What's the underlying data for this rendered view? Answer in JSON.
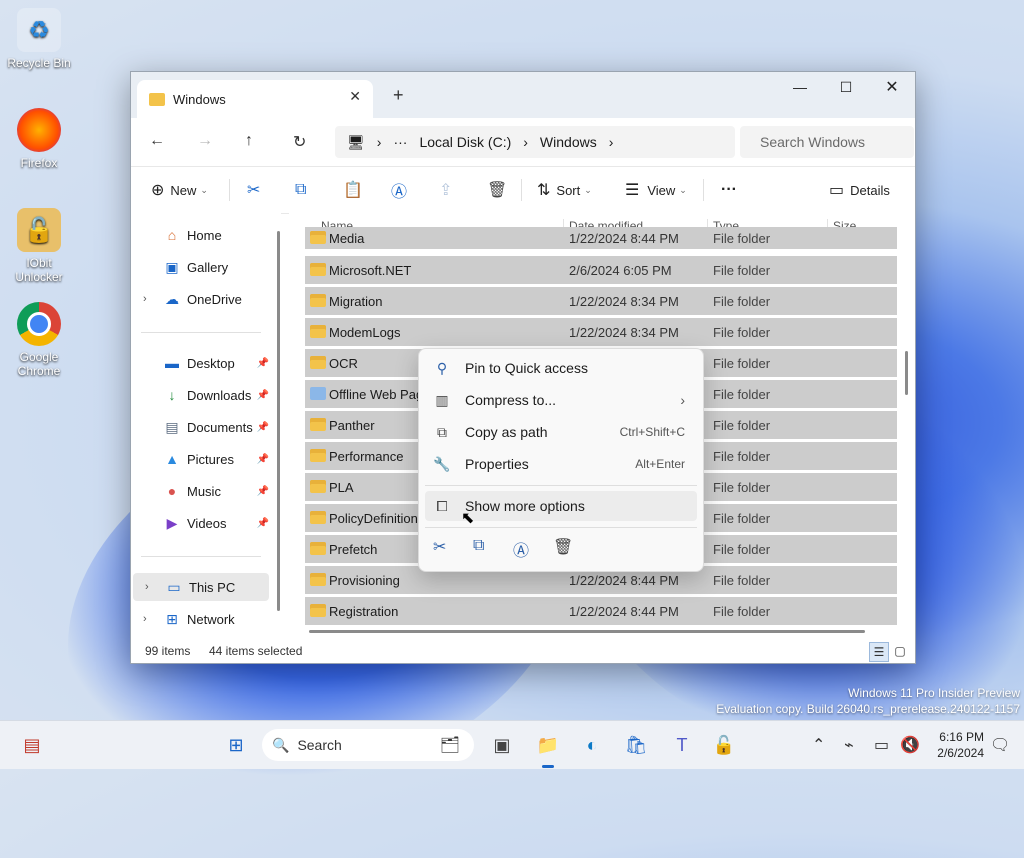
{
  "desktop": {
    "icons": [
      {
        "label": "Recycle Bin",
        "icon": "recycle-bin-icon"
      },
      {
        "label": "Firefox",
        "icon": "firefox-icon"
      },
      {
        "label": "IObit Unlocker",
        "icon": "iobit-unlocker-icon"
      },
      {
        "label": "Google Chrome",
        "icon": "chrome-icon"
      }
    ]
  },
  "explorer": {
    "tab_title": "Windows",
    "new_tab": "+",
    "address": {
      "crumbs": [
        "Local Disk  (C:)",
        "Windows"
      ],
      "more": "···",
      "search_placeholder": "Search Windows"
    },
    "toolbar": {
      "new": "New",
      "sort": "Sort",
      "view": "View",
      "more": "···",
      "details": "Details"
    },
    "nav": {
      "items": [
        {
          "label": "Home",
          "icon": "home-icon"
        },
        {
          "label": "Gallery",
          "icon": "gallery-icon"
        },
        {
          "label": "OneDrive",
          "icon": "onedrive-icon"
        },
        {
          "label": "Desktop",
          "icon": "desktop-icon",
          "pinned": true
        },
        {
          "label": "Downloads",
          "icon": "downloads-icon",
          "pinned": true
        },
        {
          "label": "Documents",
          "icon": "documents-icon",
          "pinned": true
        },
        {
          "label": "Pictures",
          "icon": "pictures-icon",
          "pinned": true
        },
        {
          "label": "Music",
          "icon": "music-icon",
          "pinned": true
        },
        {
          "label": "Videos",
          "icon": "videos-icon",
          "pinned": true
        },
        {
          "label": "This PC",
          "icon": "this-pc-icon"
        },
        {
          "label": "Network",
          "icon": "network-icon"
        }
      ]
    },
    "columns": {
      "name": "Name",
      "date": "Date modified",
      "type": "Type",
      "size": "Size"
    },
    "files": [
      {
        "name": "Media",
        "date": "1/22/2024 8:44 PM",
        "type": "File folder"
      },
      {
        "name": "Microsoft.NET",
        "date": "2/6/2024 6:05 PM",
        "type": "File folder"
      },
      {
        "name": "Migration",
        "date": "1/22/2024 8:34 PM",
        "type": "File folder"
      },
      {
        "name": "ModemLogs",
        "date": "1/22/2024 8:34 PM",
        "type": "File folder"
      },
      {
        "name": "OCR",
        "date": "",
        "type": "File folder"
      },
      {
        "name": "Offline Web Pages",
        "date": "",
        "type": "File folder"
      },
      {
        "name": "Panther",
        "date": "",
        "type": "File folder"
      },
      {
        "name": "Performance",
        "date": "",
        "type": "File folder"
      },
      {
        "name": "PLA",
        "date": "",
        "type": "File folder"
      },
      {
        "name": "PolicyDefinitions",
        "date": "",
        "type": "File folder"
      },
      {
        "name": "Prefetch",
        "date": "",
        "type": "File folder"
      },
      {
        "name": "Provisioning",
        "date": "1/22/2024 8:44 PM",
        "type": "File folder"
      },
      {
        "name": "Registration",
        "date": "1/22/2024 8:44 PM",
        "type": "File folder"
      }
    ],
    "status": {
      "count": "99 items",
      "selected": "44 items selected"
    }
  },
  "context_menu": {
    "items": [
      {
        "label": "Pin to Quick access",
        "shortcut": "",
        "icon": "pin-icon"
      },
      {
        "label": "Compress to...",
        "shortcut": "›",
        "icon": "compress-icon"
      },
      {
        "label": "Copy as path",
        "shortcut": "Ctrl+Shift+C",
        "icon": "copy-path-icon"
      },
      {
        "label": "Properties",
        "shortcut": "Alt+Enter",
        "icon": "properties-icon"
      },
      {
        "label": "Show more options",
        "shortcut": "",
        "icon": "show-more-icon"
      }
    ]
  },
  "watermark": {
    "line1": "Windows 11 Pro Insider Preview",
    "line2": "Evaluation copy. Build 26040.rs_prerelease.240122-1157"
  },
  "taskbar": {
    "search_placeholder": "Search",
    "time": "6:16 PM",
    "date": "2/6/2024"
  },
  "colors": {
    "accent": "#1a66c8",
    "selection": "#cccccc",
    "folder": "#f3c34a"
  }
}
